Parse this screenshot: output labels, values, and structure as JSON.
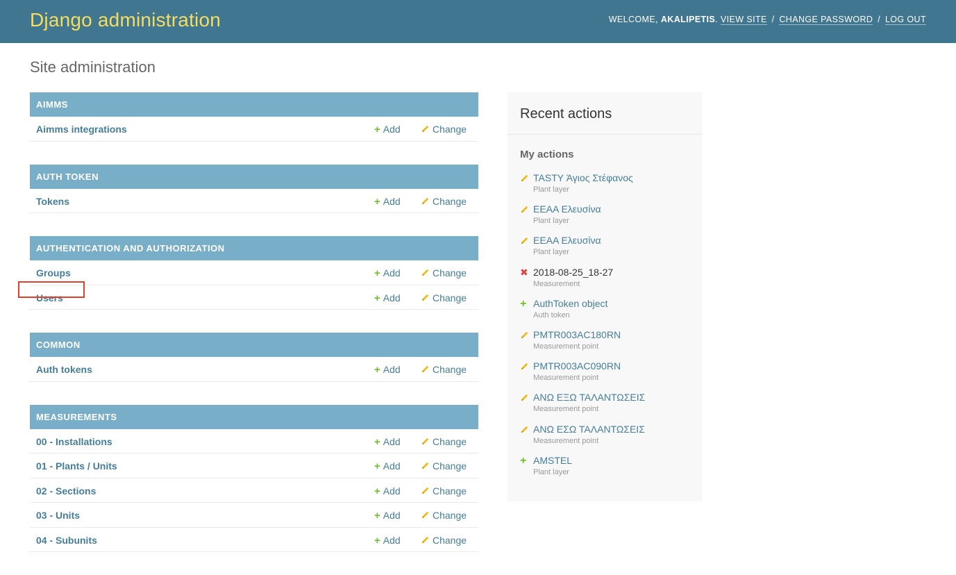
{
  "header": {
    "branding": "Django administration",
    "welcome_prefix": "WELCOME,",
    "username": "AKALIPETIS",
    "username_suffix": ".",
    "view_site": "VIEW SITE",
    "change_password": "CHANGE PASSWORD",
    "log_out": "LOG OUT",
    "sep": "/"
  },
  "page_title": "Site administration",
  "colors": {
    "header_bg": "#417690",
    "branding": "#f5dd5d",
    "module_caption_bg": "#79aec8",
    "link": "#447e9b",
    "add_icon": "#70bf2b",
    "change_icon": "#efb80b",
    "delete_icon": "#dd4646",
    "highlight_box": "#e0402b"
  },
  "modules": [
    {
      "caption": "AIMMS",
      "models": [
        {
          "name": "Aimms integrations",
          "add": "Add",
          "change": "Change"
        }
      ]
    },
    {
      "caption": "AUTH TOKEN",
      "models": [
        {
          "name": "Tokens",
          "add": "Add",
          "change": "Change"
        }
      ]
    },
    {
      "caption": "AUTHENTICATION AND AUTHORIZATION",
      "models": [
        {
          "name": "Groups",
          "add": "Add",
          "change": "Change"
        },
        {
          "name": "Users",
          "add": "Add",
          "change": "Change",
          "highlighted": true
        }
      ]
    },
    {
      "caption": "COMMON",
      "models": [
        {
          "name": "Auth tokens",
          "add": "Add",
          "change": "Change"
        }
      ]
    },
    {
      "caption": "MEASUREMENTS",
      "models": [
        {
          "name": "00 - Installations",
          "add": "Add",
          "change": "Change"
        },
        {
          "name": "01 - Plants / Units",
          "add": "Add",
          "change": "Change"
        },
        {
          "name": "02 - Sections",
          "add": "Add",
          "change": "Change"
        },
        {
          "name": "03 - Units",
          "add": "Add",
          "change": "Change"
        },
        {
          "name": "04 - Subunits",
          "add": "Add",
          "change": "Change"
        }
      ]
    }
  ],
  "recent_actions": {
    "title": "Recent actions",
    "my_actions_title": "My actions",
    "items": [
      {
        "icon": "pencil-icon",
        "kind": "change",
        "label": "TASTY Άγιος Στέφανος",
        "type": "Plant layer"
      },
      {
        "icon": "pencil-icon",
        "kind": "change",
        "label": "ΕΕΑΑ Ελευσίνα",
        "type": "Plant layer"
      },
      {
        "icon": "pencil-icon",
        "kind": "change",
        "label": "ΕΕΑΑ Ελευσίνα",
        "type": "Plant layer"
      },
      {
        "icon": "delete-icon",
        "kind": "delete",
        "label": "2018-08-25_18-27",
        "type": "Measurement"
      },
      {
        "icon": "plus-icon",
        "kind": "add",
        "label": "AuthToken object",
        "type": "Auth token"
      },
      {
        "icon": "pencil-icon",
        "kind": "change",
        "label": "PMTR003AC180RN",
        "type": "Measurement point"
      },
      {
        "icon": "pencil-icon",
        "kind": "change",
        "label": "PMTR003AC090RN",
        "type": "Measurement point"
      },
      {
        "icon": "pencil-icon",
        "kind": "change",
        "label": "ΑΝΩ ΕΞΩ ΤΑΛΑΝΤΩΣΕΙΣ",
        "type": "Measurement point"
      },
      {
        "icon": "pencil-icon",
        "kind": "change",
        "label": "ΑΝΩ ΕΣΩ ΤΑΛΑΝΤΩΣΕΙΣ",
        "type": "Measurement point"
      },
      {
        "icon": "plus-icon",
        "kind": "add",
        "label": "AMSTEL",
        "type": "Plant layer"
      }
    ]
  }
}
